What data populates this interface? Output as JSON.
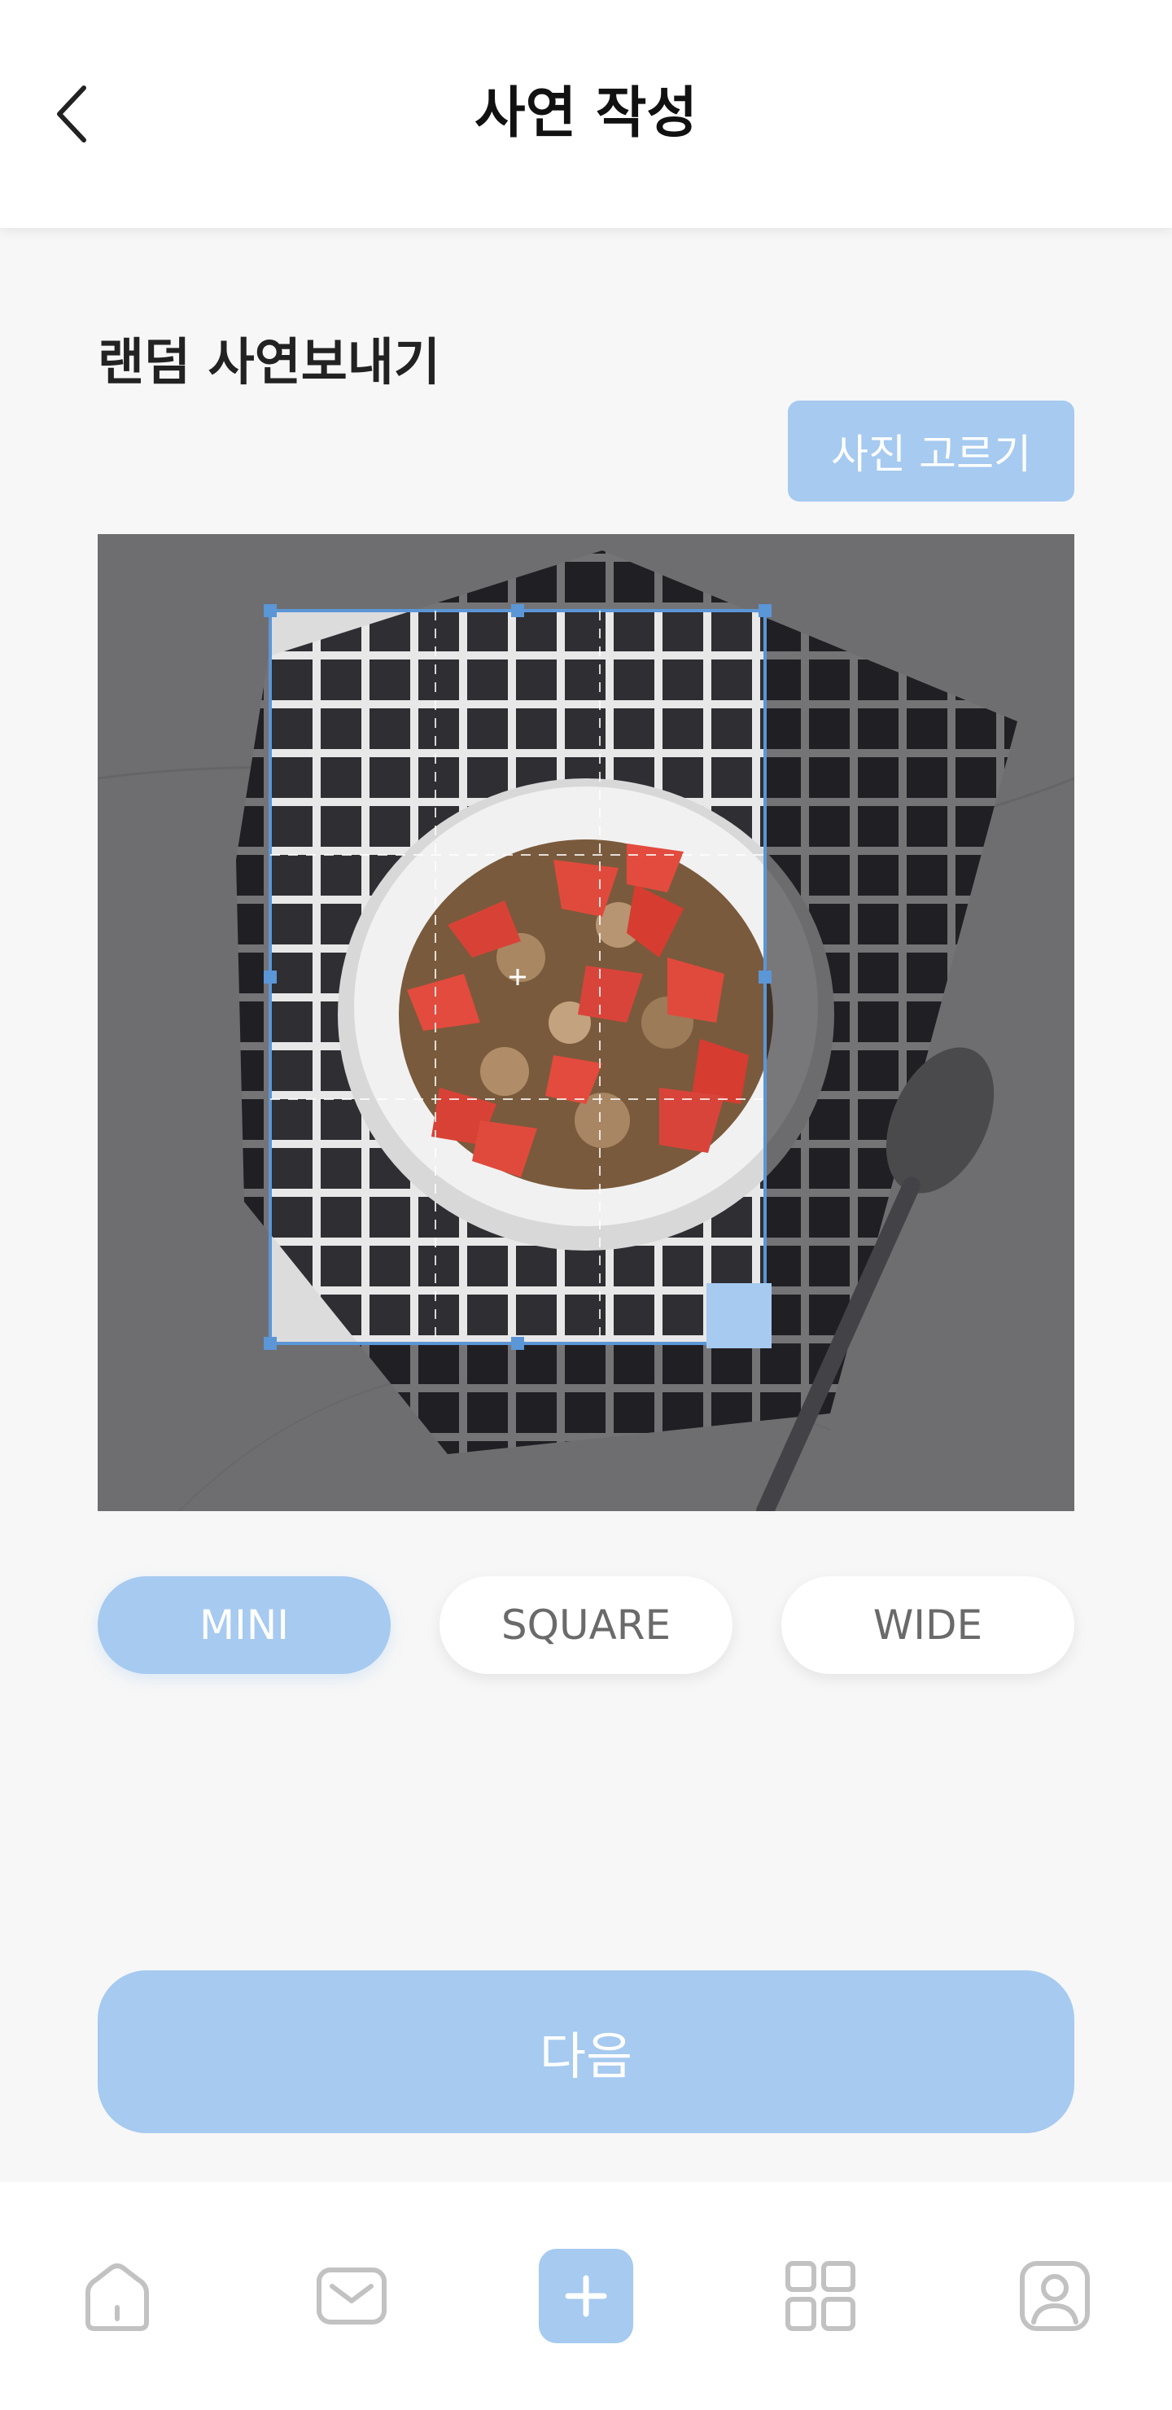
{
  "header": {
    "title": "사연 작성",
    "back_icon": "chevron-left-icon"
  },
  "section": {
    "title": "랜덤 사연보내기",
    "pick_photo_label": "사진 고르기"
  },
  "photo": {
    "description_icon": "photo-cereal-bowl"
  },
  "formats": {
    "selected": "MINI",
    "options": [
      "MINI",
      "SQUARE",
      "WIDE"
    ]
  },
  "next_label": "다음",
  "bottom_nav": {
    "items": [
      "home-icon",
      "mail-icon",
      "plus-icon",
      "grid-icon",
      "profile-icon"
    ]
  },
  "colors": {
    "accent": "#a6caf0",
    "crop_border": "#5b96d6"
  }
}
